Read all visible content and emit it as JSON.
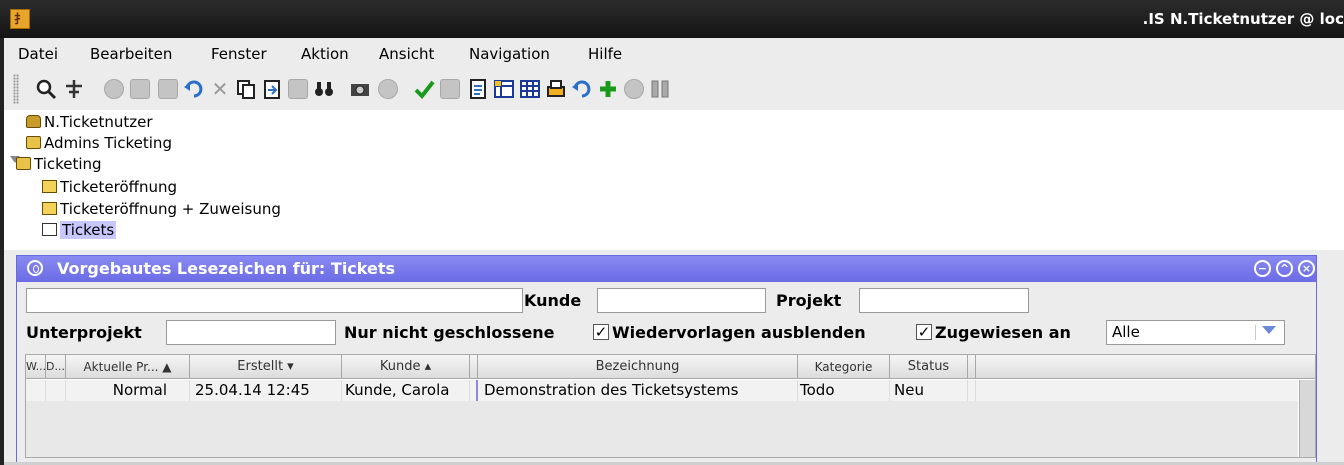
{
  "window": {
    "title": ".IS  N.Ticketnutzer @ loc"
  },
  "menubar": [
    {
      "label": "Datei"
    },
    {
      "label": "Bearbeiten"
    },
    {
      "label": "Fenster"
    },
    {
      "label": "Aktion"
    },
    {
      "label": "Ansicht"
    },
    {
      "label": "Navigation"
    },
    {
      "label": "Hilfe"
    }
  ],
  "toolbar": {
    "icons": [
      "search-icon",
      "navigate-icon",
      "info-icon",
      "folder-icon",
      "edit-icon",
      "undo-icon",
      "cut-icon",
      "copy-icon",
      "paste-icon",
      "clipboard-icon",
      "binoculars-icon",
      "camera-icon",
      "back-icon",
      "check-icon",
      "calendar-icon",
      "document-icon",
      "table-add-icon",
      "table-icon",
      "print-icon",
      "redo-icon",
      "add-icon",
      "stop-icon",
      "columns-icon"
    ]
  },
  "tree": {
    "nodes": [
      {
        "label": "N.Ticketnutzer",
        "icon": "lock-icon"
      },
      {
        "label": "Admins Ticketing",
        "icon": "folder-icon"
      },
      {
        "label": "Ticketing",
        "icon": "folder-open-icon"
      },
      {
        "label": "Ticketeröffnung",
        "icon": "star-doc-icon"
      },
      {
        "label": "Ticketeröffnung + Zuweisung",
        "icon": "star-doc-icon"
      },
      {
        "label": "Tickets",
        "icon": "bookmark-doc-icon"
      }
    ]
  },
  "panel": {
    "title": "Vorgebautes Lesezeichen für: Tickets",
    "filters": {
      "search_value": "",
      "kunde_label": "Kunde",
      "kunde_value": "",
      "projekt_label": "Projekt",
      "projekt_value": "",
      "unterprojekt_label": "Unterprojekt",
      "unterprojekt_value": "",
      "nur_nicht_geschlossene_label": "Nur nicht geschlossene",
      "nur_nicht_geschlossene_checked": "✓",
      "wiedervorlagen_label": "Wiedervorlagen ausblenden",
      "wiedervorlagen_checked": "✓",
      "zugewiesen_label": "Zugewiesen an",
      "zugewiesen_value": "Alle"
    },
    "table": {
      "columns": [
        "W...",
        "D...",
        "Aktuelle Pr... ▲",
        "Erstellt ▾",
        "Kunde ▴",
        "",
        "Bezeichnung",
        "Kategorie",
        "Status",
        ""
      ],
      "rows": [
        [
          "",
          "",
          "Normal",
          "25.04.14 12:45",
          "Kunde, Carola",
          "",
          "Demonstration des Ticketsystems",
          "Todo",
          "Neu",
          ""
        ]
      ]
    }
  }
}
